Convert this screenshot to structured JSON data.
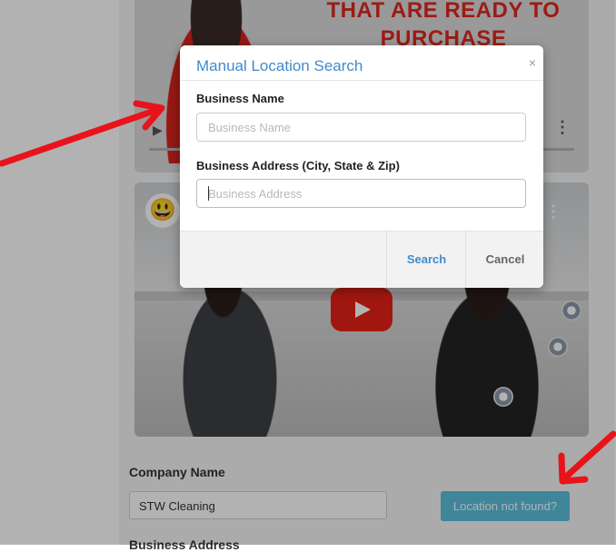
{
  "background": {
    "promo_line1": "THAT ARE READY TO",
    "promo_line2": "PURCHASE",
    "company_label": "Company Name",
    "company_value": "STW Cleaning",
    "location_not_found_label": "Location not found?",
    "cut_label": "Business Address"
  },
  "modal": {
    "title": "Manual Location Search",
    "close_symbol": "×",
    "business_name_label": "Business Name",
    "business_name_placeholder": "Business Name",
    "business_name_value": "",
    "business_address_label": "Business Address (City, State & Zip)",
    "business_address_placeholder": "Business Address",
    "business_address_value": "",
    "search_label": "Search",
    "cancel_label": "Cancel"
  },
  "colors": {
    "accent": "#428bca",
    "info_button": "#5bc0de",
    "annotation_arrow": "#e8131b",
    "video_play": "#e62117"
  },
  "icons": {
    "close": "close-icon",
    "play": "play-icon",
    "more": "more-vertical-icon",
    "arrow": "annotation-arrow-icon"
  }
}
